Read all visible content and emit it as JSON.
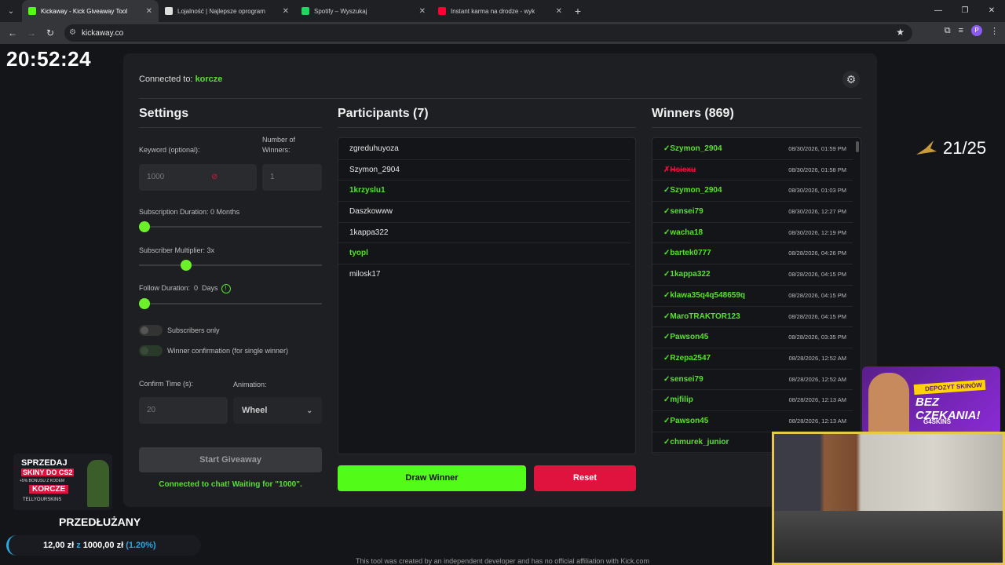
{
  "browser": {
    "tabs": [
      {
        "title": "Kickaway - Kick Giveaway Tool",
        "favicon_color": "#53fc18",
        "active": true
      },
      {
        "title": "Lojalność | Najlepsze oprogram",
        "favicon_color": "#dddddd",
        "active": false
      },
      {
        "title": "Spotify – Wyszukaj",
        "favicon_color": "#1ed760",
        "active": false
      },
      {
        "title": "Instant karma na drodze - wyk",
        "favicon_color": "#ff0033",
        "active": false
      }
    ],
    "url": "kickaway.co",
    "profile_initial": "P"
  },
  "overlay": {
    "clock": "20:52:24",
    "counter": "21/25",
    "promo": {
      "top": "⚡DEPOZYT SKINÓW",
      "main": "BEZ CZEKANIA!",
      "brand": "G4SKINS"
    },
    "ad_left": {
      "line1": "SPRZEDAJ",
      "line2": "SKINY DO CS2",
      "line3": "+5% BONUSU Z KODEM",
      "code": "KORCZE",
      "brand": "TELLYOURSKINS"
    },
    "prolong_label": "PRZEDŁUŻANY",
    "goal": {
      "current": "12,00 zł",
      "sep": "z",
      "target": "1000,00 zł",
      "percent": "(1.20%)",
      "progress": 0.012
    }
  },
  "app": {
    "connected_label": "Connected to:",
    "channel": "korcze",
    "settings": {
      "title": "Settings",
      "keyword_label": "Keyword (optional):",
      "keyword_value": "1000",
      "winners_label": "Number of Winners:",
      "winners_value": "1",
      "sub_duration_label": "Subscription Duration: 0 Months",
      "sub_duration_level": 0,
      "sub_multiplier_label": "Subscriber Multiplier: 3x",
      "sub_multiplier_level": 0.24,
      "follow_label": "Follow Duration:  0  Days",
      "follow_level": 0,
      "subs_only_label": "Subscribers only",
      "confirm_label": "Winner confirmation (for single winner)",
      "confirm_time_label": "Confirm Time (s):",
      "confirm_time_value": "20",
      "animation_label": "Animation:",
      "animation_value": "Wheel",
      "start_button": "Start Giveaway",
      "status": "Connected to chat! Waiting for \"1000\"."
    },
    "participants": {
      "title": "Participants (7)",
      "items": [
        {
          "name": "zgreduhuyoza",
          "highlight": false
        },
        {
          "name": "Szymon_2904",
          "highlight": false
        },
        {
          "name": "1krzyslu1",
          "highlight": true
        },
        {
          "name": "Daszkowww",
          "highlight": false
        },
        {
          "name": "1kappa322",
          "highlight": false
        },
        {
          "name": "tyopl",
          "highlight": true
        },
        {
          "name": "milosk17",
          "highlight": false
        }
      ]
    },
    "draw_button": "Draw Winner",
    "reset_button": "Reset",
    "winners": {
      "title": "Winners (869)",
      "items": [
        {
          "mark": "✓",
          "name": "Szymon_2904",
          "date": "08/30/2026, 01:59 PM",
          "lost": false
        },
        {
          "mark": "✗",
          "name": "Hsiexu",
          "date": "08/30/2026, 01:58 PM",
          "lost": true
        },
        {
          "mark": "✓",
          "name": "Szymon_2904",
          "date": "08/30/2026, 01:03 PM",
          "lost": false
        },
        {
          "mark": "✓",
          "name": "sensei79",
          "date": "08/30/2026, 12:27 PM",
          "lost": false
        },
        {
          "mark": "✓",
          "name": "wacha18",
          "date": "08/30/2026, 12:19 PM",
          "lost": false
        },
        {
          "mark": "✓",
          "name": "bartek0777",
          "date": "08/28/2026, 04:26 PM",
          "lost": false
        },
        {
          "mark": "✓",
          "name": "1kappa322",
          "date": "08/28/2026, 04:15 PM",
          "lost": false
        },
        {
          "mark": "✓",
          "name": "klawa35q4q548659q",
          "date": "08/28/2026, 04:15 PM",
          "lost": false
        },
        {
          "mark": "✓",
          "name": "MaroTRAKTOR123",
          "date": "08/28/2026, 04:15 PM",
          "lost": false
        },
        {
          "mark": "✓",
          "name": "Pawson45",
          "date": "08/28/2026, 03:35 PM",
          "lost": false
        },
        {
          "mark": "✓",
          "name": "Rzepa2547",
          "date": "08/28/2026, 12:52 AM",
          "lost": false
        },
        {
          "mark": "✓",
          "name": "sensei79",
          "date": "08/28/2026, 12:52 AM",
          "lost": false
        },
        {
          "mark": "✓",
          "name": "mjfilip",
          "date": "08/28/2026, 12:13 AM",
          "lost": false
        },
        {
          "mark": "✓",
          "name": "Pawson45",
          "date": "08/28/2026, 12:13 AM",
          "lost": false
        },
        {
          "mark": "✓",
          "name": "chmurek_junior",
          "date": "",
          "lost": false
        }
      ]
    },
    "footer": "This tool was created by an independent developer and has no official affiliation with Kick.com"
  }
}
